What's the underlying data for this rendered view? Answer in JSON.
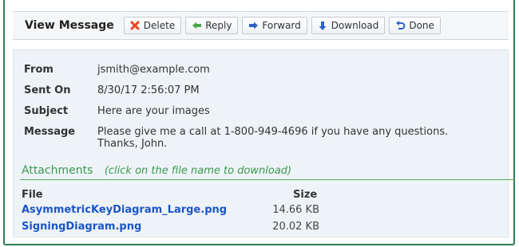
{
  "toolbar": {
    "title": "View Message",
    "buttons": [
      {
        "label": "Delete",
        "icon": "x-icon",
        "color": "#e8461e"
      },
      {
        "label": "Reply",
        "icon": "reply-arrow-icon",
        "color": "#4aa84a"
      },
      {
        "label": "Forward",
        "icon": "forward-arrow-icon",
        "color": "#2a62c9"
      },
      {
        "label": "Download",
        "icon": "download-arrow-icon",
        "color": "#2a62c9"
      },
      {
        "label": "Done",
        "icon": "undo-arrow-icon",
        "color": "#2a62c9"
      }
    ]
  },
  "message": {
    "from_label": "From",
    "from_value": "jsmith@example.com",
    "sent_label": "Sent On",
    "sent_value": "8/30/17 2:56:07 PM",
    "subject_label": "Subject",
    "subject_value": "Here are your images",
    "message_label": "Message",
    "message_line1": "Please give me a call at 1-800-949-4696 if you have any questions.",
    "message_line2": "Thanks, John."
  },
  "attachments": {
    "title": "Attachments",
    "hint": "(click on the file name to download)",
    "col_file": "File",
    "col_size": "Size",
    "files": [
      {
        "name": "AsymmetricKeyDiagram_Large.png",
        "size": "14.66 KB"
      },
      {
        "name": "SigningDiagram.png",
        "size": "20.02 KB"
      }
    ]
  },
  "colors": {
    "frame": "#2e7d57",
    "link": "#1a56c7",
    "attach_green": "#3a9a4e"
  }
}
